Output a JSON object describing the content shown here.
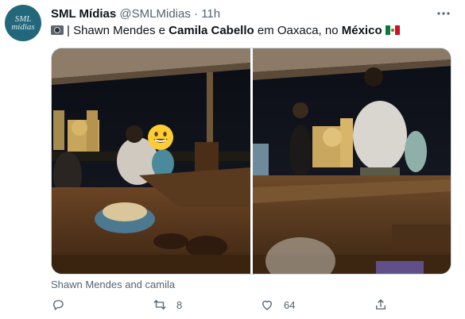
{
  "author": {
    "avatar_text_line1": "SML",
    "avatar_text_line2": "mídias",
    "name": "SML Mídias",
    "handle": "@SMLMidias",
    "separator": "·",
    "time": "11h"
  },
  "tweet": {
    "prefix": "| Shawn Mendes e ",
    "bold1": "Camila Cabello",
    "middle": " em Oaxaca, no ",
    "bold2": "México",
    "caption": "Shawn Mendes and camila"
  },
  "actions": {
    "reply_count": "",
    "retweet_count": "8",
    "like_count": "64",
    "share_count": ""
  },
  "icons": [
    "camera-icon",
    "mexico-flag-icon",
    "more-icon",
    "reply-icon",
    "retweet-icon",
    "like-icon",
    "share-icon",
    "emoji-face-icon"
  ]
}
